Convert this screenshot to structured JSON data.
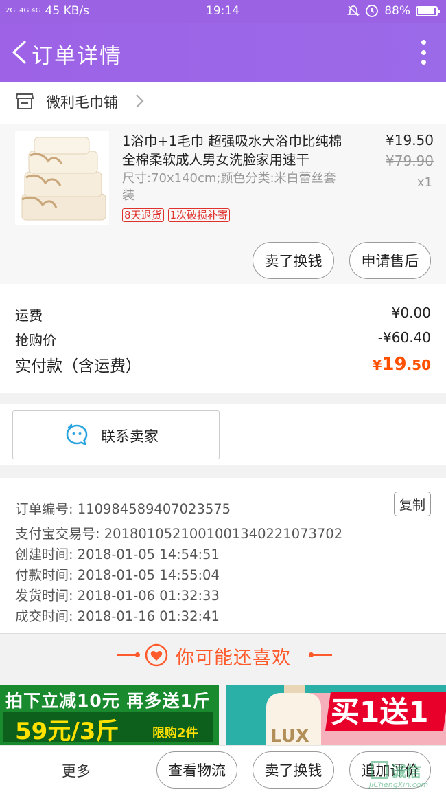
{
  "status_bar": {
    "signal_left": "2G",
    "signal_right": "4G 4G",
    "net_speed": "45 KB/s",
    "time": "19:14",
    "battery_level": 0.88,
    "battery_text": "88%",
    "icons": [
      "mute-bell-icon",
      "alarm-icon",
      "battery-icon"
    ]
  },
  "nav": {
    "title": "订单详情",
    "back_icon": "chevron-left-icon",
    "more_icon": "more-vertical-icon"
  },
  "shop": {
    "name": "微利毛巾铺",
    "icon": "store-icon"
  },
  "product": {
    "title": "1浴巾+1毛巾 超强吸水大浴巾比纯棉全棉柔软成人男女洗脸家用速干",
    "sku": "尺寸:70x140cm;颜色分类:米白蕾丝套装",
    "price": "¥19.50",
    "original_price": "¥79.90",
    "quantity": "x1",
    "badges": [
      "8天退货",
      "1次破损补寄"
    ],
    "actions": [
      "卖了换钱",
      "申请售后"
    ]
  },
  "summary": {
    "shipping_label": "运费",
    "shipping_value": "¥0.00",
    "discount_label": "抢购价",
    "discount_value": "-¥60.40",
    "total_label": "实付款（含运费）",
    "total_yen": "¥",
    "total_int": "19",
    "total_dec": ".50",
    "accent_color": "#ff5000"
  },
  "contact": {
    "label": "联系卖家",
    "icon": "chat-bubble-icon"
  },
  "order_info": {
    "order_no": "订单编号: 110984589407023575",
    "copy_label": "复制",
    "alipay_no": "支付宝交易号: 2018010521001001340221073702",
    "created": "创建时间: 2018-01-05 14:54:51",
    "paid": "付款时间: 2018-01-05 14:55:04",
    "shipped": "发货时间: 2018-01-06 01:32:33",
    "completed": "成交时间: 2018-01-16 01:32:41"
  },
  "recommend": {
    "title": "你可能还喜欢",
    "icon": "heart-icon"
  },
  "ads": {
    "left_line1": "拍下立减10元 再多送1斤",
    "left_line2": "59元/3斤",
    "left_line3": "限购2件",
    "right_brand": "LUX",
    "right_promo": "买1送1"
  },
  "bottom_bar": {
    "more": "更多",
    "logistics": "查看物流",
    "sell": "卖了换钱",
    "review": "追加评价",
    "watermark_text": "诚信",
    "watermark_url": "JiChengXin.com"
  }
}
